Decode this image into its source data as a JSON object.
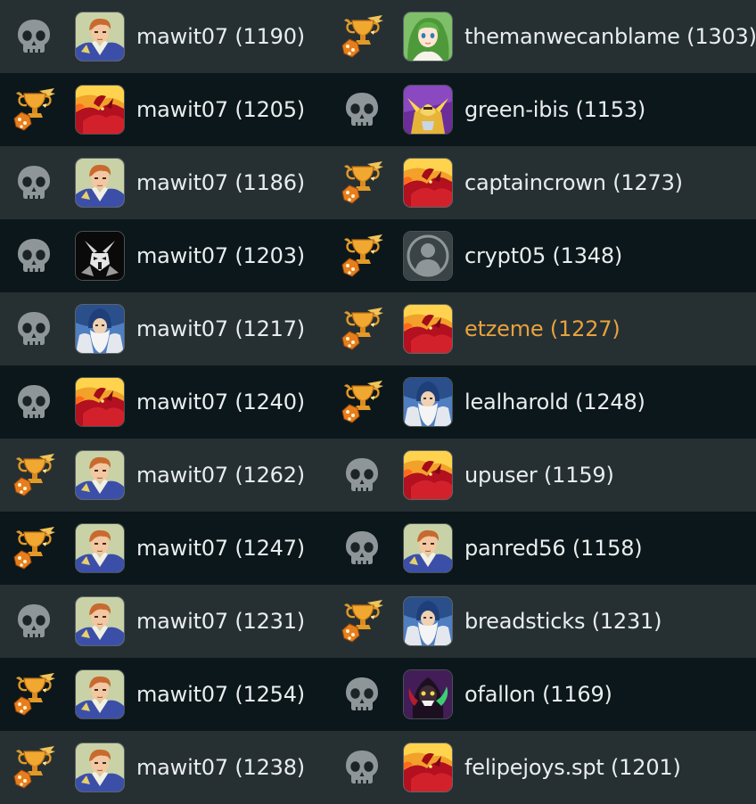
{
  "colors": {
    "row_odd": "#263033",
    "row_even": "#0c171b",
    "text": "#e9edee",
    "highlight_text": "#e8a23d",
    "skull": "#8e9699",
    "trophy": "#e8a23d"
  },
  "matches": [
    {
      "p1": {
        "result": "loss",
        "avatar": "adventurer-portrait",
        "name": "mawit07 (1190)"
      },
      "p2": {
        "result": "win",
        "avatar": "green-haired-girl-portrait",
        "name": "themanwecanblame (1303)"
      }
    },
    {
      "p1": {
        "result": "win",
        "avatar": "red-dragon-portrait",
        "name": "mawit07 (1205)"
      },
      "p2": {
        "result": "loss",
        "avatar": "golden-knight-portrait",
        "name": "green-ibis (1153)"
      }
    },
    {
      "p1": {
        "result": "loss",
        "avatar": "adventurer-portrait",
        "name": "mawit07 (1186)"
      },
      "p2": {
        "result": "win",
        "avatar": "red-dragon-portrait",
        "name": "captaincrown (1273)"
      }
    },
    {
      "p1": {
        "result": "loss",
        "avatar": "black-robot-portrait",
        "name": "mawit07 (1203)"
      },
      "p2": {
        "result": "win",
        "avatar": "default-user-portrait",
        "name": "crypt05 (1348)"
      }
    },
    {
      "p1": {
        "result": "loss",
        "avatar": "wizard-portrait",
        "name": "mawit07 (1217)"
      },
      "p2": {
        "result": "win",
        "avatar": "red-dragon-portrait",
        "name": "etzeme (1227)",
        "highlight": true
      }
    },
    {
      "p1": {
        "result": "loss",
        "avatar": "red-dragon-portrait",
        "name": "mawit07 (1240)"
      },
      "p2": {
        "result": "win",
        "avatar": "wizard-portrait",
        "name": "lealharold (1248)"
      }
    },
    {
      "p1": {
        "result": "win",
        "avatar": "adventurer-portrait",
        "name": "mawit07 (1262)"
      },
      "p2": {
        "result": "loss",
        "avatar": "red-dragon-portrait",
        "name": "upuser (1159)"
      }
    },
    {
      "p1": {
        "result": "win",
        "avatar": "adventurer-portrait",
        "name": "mawit07 (1247)"
      },
      "p2": {
        "result": "loss",
        "avatar": "adventurer-portrait",
        "name": "panred56 (1158)"
      }
    },
    {
      "p1": {
        "result": "loss",
        "avatar": "adventurer-portrait",
        "name": "mawit07 (1231)"
      },
      "p2": {
        "result": "win",
        "avatar": "wizard-portrait",
        "name": "breadsticks (1231)"
      }
    },
    {
      "p1": {
        "result": "win",
        "avatar": "adventurer-portrait",
        "name": "mawit07 (1254)"
      },
      "p2": {
        "result": "loss",
        "avatar": "dark-sorcerer-portrait",
        "name": "ofallon (1169)"
      }
    },
    {
      "p1": {
        "result": "win",
        "avatar": "adventurer-portrait",
        "name": "mawit07 (1238)"
      },
      "p2": {
        "result": "loss",
        "avatar": "red-dragon-portrait",
        "name": "felipejoys.spt (1201)"
      }
    }
  ]
}
